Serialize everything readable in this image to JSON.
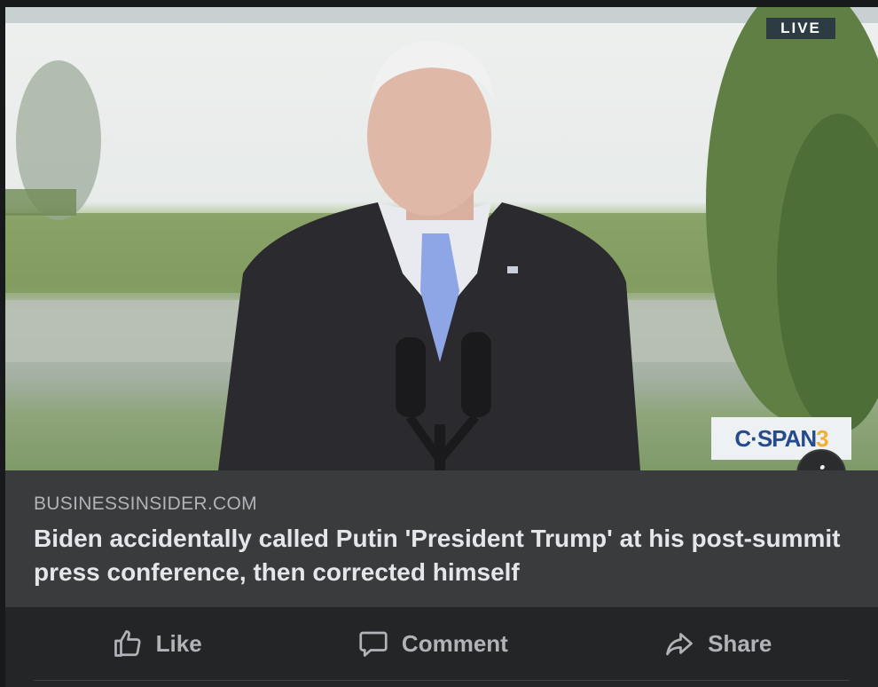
{
  "media": {
    "live_badge": "LIVE",
    "network_logo": "C·SPAN",
    "network_channel": "3",
    "info_icon": "info-icon"
  },
  "preview": {
    "source": "BUSINESSINSIDER.COM",
    "headline": "Biden accidentally called Putin 'President Trump' at his post-summit press conference, then corrected himself"
  },
  "actions": [
    {
      "label": "Like",
      "icon": "thumbs-up-icon"
    },
    {
      "label": "Comment",
      "icon": "comment-icon"
    },
    {
      "label": "Share",
      "icon": "share-icon"
    }
  ]
}
